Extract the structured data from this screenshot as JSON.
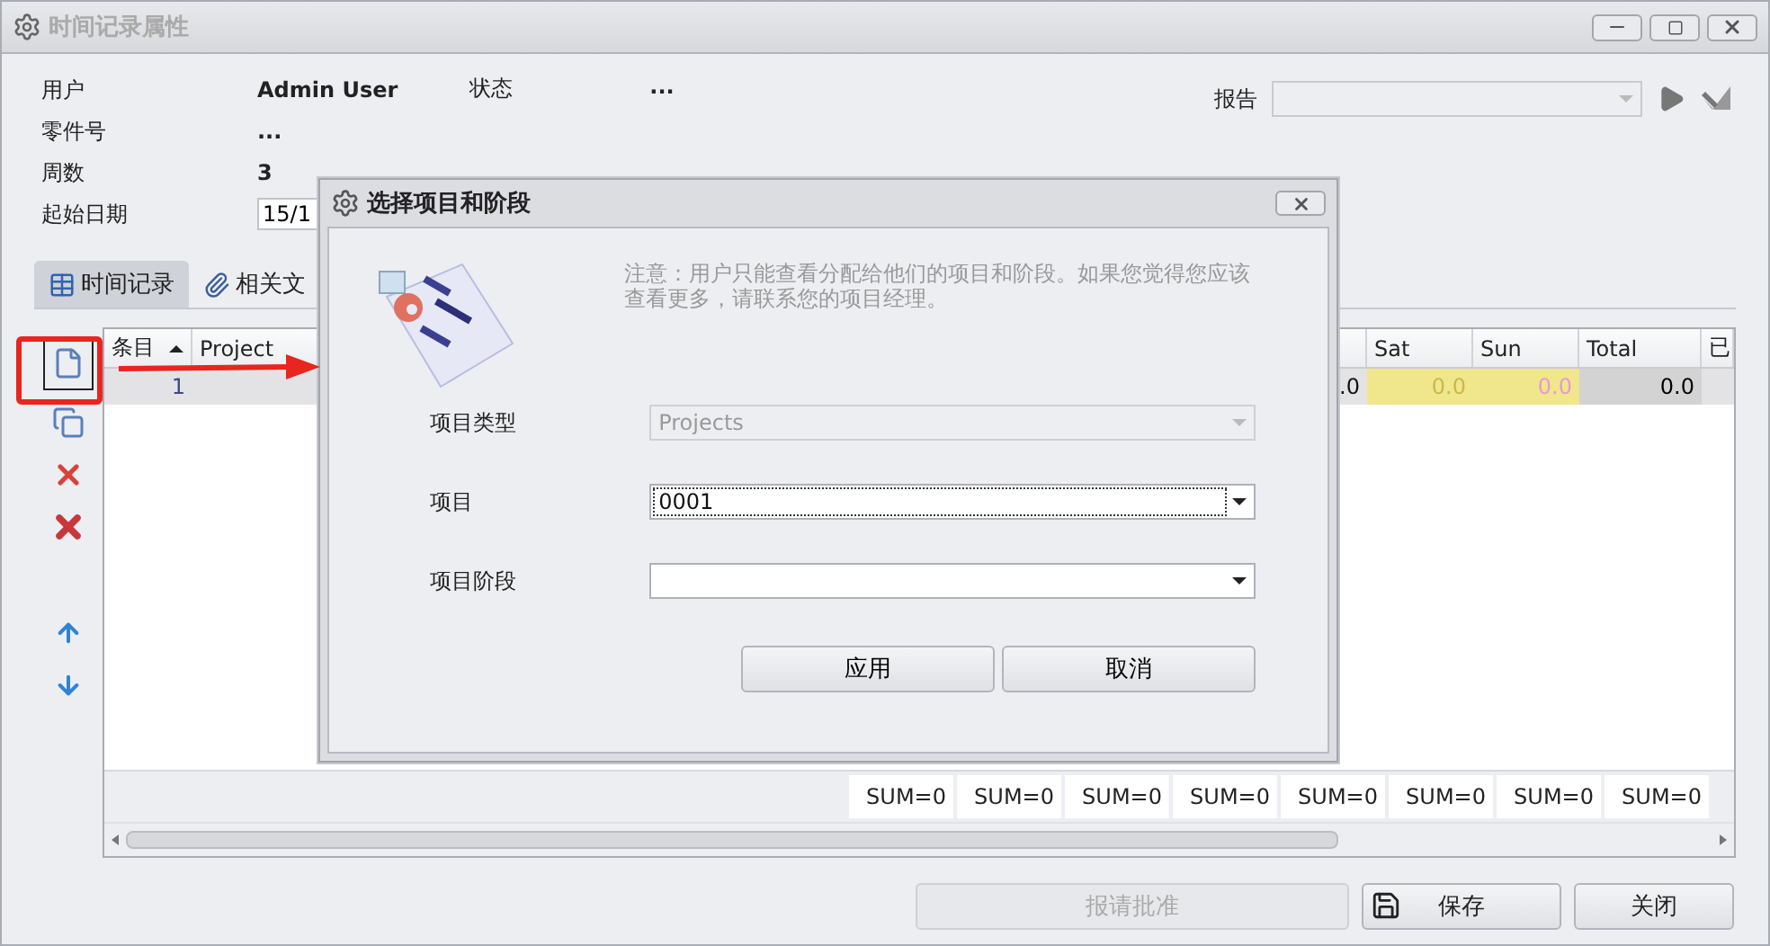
{
  "window": {
    "title": "时间记录属性"
  },
  "info": [
    {
      "label": "用户",
      "value": "Admin User"
    },
    {
      "label": "零件号",
      "value": "..."
    },
    {
      "label": "周数",
      "value": "3"
    }
  ],
  "start_date": {
    "label": "起始日期",
    "value": "15/1"
  },
  "status": {
    "label": "状态",
    "value": "..."
  },
  "report": {
    "label": "报告",
    "disabled": true
  },
  "tabs": [
    {
      "label": "时间记录",
      "selected": true,
      "kind": "table"
    },
    {
      "label": "相关文",
      "selected": false,
      "kind": "clip"
    }
  ],
  "toolbar": [
    {
      "kind": "new",
      "highlighted": true
    },
    {
      "kind": "copy",
      "highlighted": false
    },
    {
      "kind": "delete",
      "highlighted": false
    },
    {
      "kind": "delete-all",
      "highlighted": false
    },
    {
      "kind": "up",
      "highlighted": false
    },
    {
      "kind": "down",
      "highlighted": false
    }
  ],
  "grid": {
    "columns_left": [
      {
        "label": "条目",
        "sorted": true
      },
      {
        "label": "Project",
        "sorted": false
      }
    ],
    "columns_right": [
      "Sat",
      "Sun",
      "Total",
      "已"
    ],
    "row": {
      "entry": "1",
      "partial": ".0",
      "cells": [
        {
          "text": "0.0",
          "color": "#c9b84a"
        },
        {
          "text": "0.0",
          "color": "#e79ad6"
        },
        {
          "text": "0.0",
          "color": "#000000"
        }
      ]
    },
    "sums": [
      "SUM=0",
      "SUM=0",
      "SUM=0",
      "SUM=0",
      "SUM=0",
      "SUM=0",
      "SUM=0",
      "SUM=0"
    ]
  },
  "buttons": [
    {
      "label": "报请批准",
      "disabled": true,
      "icon": false
    },
    {
      "label": "保存",
      "disabled": false,
      "icon": true
    },
    {
      "label": "关闭",
      "disabled": false,
      "icon": false
    }
  ],
  "dialog": {
    "title": "选择项目和阶段",
    "note": "注意：用户只能查看分配给他们的项目和阶段。如果您觉得您应该查看更多，请联系您的项目经理。",
    "fields": [
      {
        "label": "项目类型",
        "value": "Projects",
        "disabled": true,
        "focused": false
      },
      {
        "label": "项目",
        "value": "0001",
        "disabled": false,
        "focused": true
      },
      {
        "label": "项目阶段",
        "disabled": false,
        "focused": false
      }
    ],
    "buttons": [
      "应用",
      "取消"
    ]
  }
}
